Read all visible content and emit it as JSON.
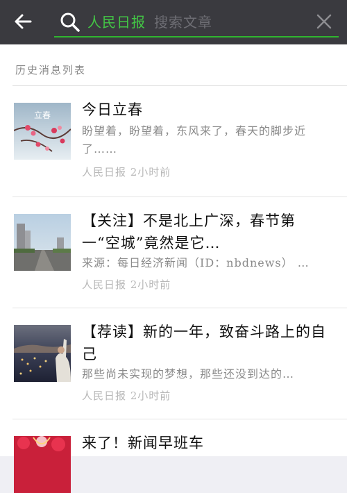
{
  "search": {
    "query": "人民日报",
    "placeholder": "搜索文章"
  },
  "section": {
    "header": "历史消息列表"
  },
  "articles": [
    {
      "title": "今日立春",
      "desc": "盼望着，盼望着，东风来了，春天的脚步近了……",
      "meta": "人民日报 2小时前",
      "thumb_text": "立春"
    },
    {
      "title": "【关注】不是北上广深，春节第一“空城”竟然是它…",
      "desc": "来源：每日经济新闻（ID：nbdnews）  …",
      "meta": "人民日报 2小时前"
    },
    {
      "title": "【荐读】新的一年，致奋斗路上的自己",
      "desc": "那些尚未实现的梦想，那些还没到达的…",
      "meta": "人民日报 2小时前"
    },
    {
      "title": "来了！新闻早班车",
      "desc": "",
      "meta": ""
    }
  ],
  "colors": {
    "topbar": "#3a3a3f",
    "accent": "#43c645",
    "background": "#ffffff"
  }
}
